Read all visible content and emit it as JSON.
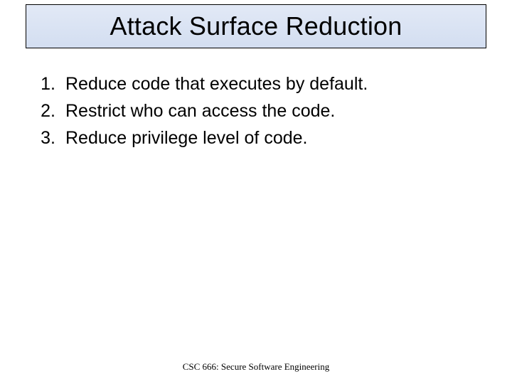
{
  "title": "Attack Surface Reduction",
  "items": [
    {
      "n": "1.",
      "text": "Reduce code that executes by default."
    },
    {
      "n": "2.",
      "text": "Restrict who can access the code."
    },
    {
      "n": "3.",
      "text": "Reduce privilege level of code."
    }
  ],
  "footer": "CSC 666: Secure Software Engineering"
}
